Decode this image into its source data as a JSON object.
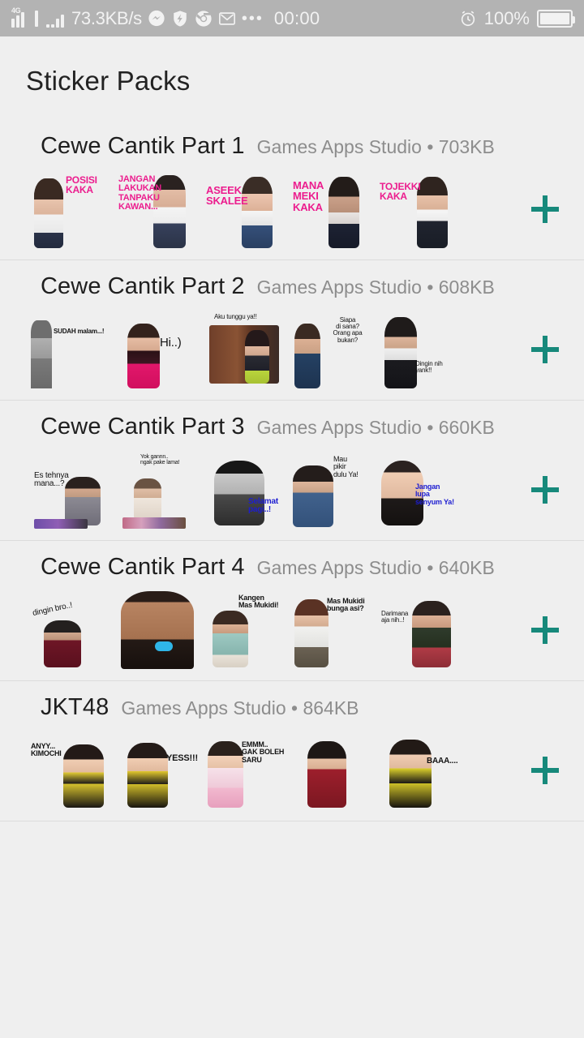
{
  "statusbar": {
    "network_label": "4G",
    "speed": "73.3KB/s",
    "time": "00:00",
    "battery_percent": "100%",
    "icons": [
      "messenger-icon",
      "shield-icon",
      "chrome-icon",
      "gmail-icon",
      "more-dots-icon",
      "alarm-icon",
      "battery-icon"
    ]
  },
  "header": {
    "title": "Sticker Packs"
  },
  "add_button_label": "+",
  "publisher": "Games Apps Studio",
  "packs": [
    {
      "name": "Cewe Cantik Part 1",
      "meta": "Games Apps Studio • 703KB",
      "stickers": [
        {
          "caption": "POSISI\nKAKA",
          "color": "pink"
        },
        {
          "caption": "JANGAN\nLAKUKAN\nTANPAKU\nKAWAN...",
          "color": "pink"
        },
        {
          "caption": "ASEEK\nSKALEE",
          "color": "pink"
        },
        {
          "caption": "MANA\nMEKI\nKAKA",
          "color": "pink"
        },
        {
          "caption": "TOJEKKI\nKAKA",
          "color": "pink"
        }
      ]
    },
    {
      "name": "Cewe Cantik Part 2",
      "meta": "Games Apps Studio • 608KB",
      "stickers": [
        {
          "caption": "SUDAH malam...!",
          "color": "black"
        },
        {
          "caption": "Hi..)",
          "color": "black"
        },
        {
          "caption": "Aku tunggu ya!!",
          "color": "black"
        },
        {
          "caption": "Siapa\ndi sana?\nOrang apa bukan?",
          "color": "black"
        },
        {
          "caption": "Dingin nih\nyank!!",
          "color": "black"
        }
      ]
    },
    {
      "name": "Cewe Cantik Part 3",
      "meta": "Games Apps Studio • 660KB",
      "stickers": [
        {
          "caption": "Es tehnya\nmana...?",
          "color": "black"
        },
        {
          "caption": "Yok gannn..\nngak pake lama!",
          "color": "black"
        },
        {
          "caption": "Selamat\npagi..!",
          "color": "blue"
        },
        {
          "caption": "Mau\npikir\ndulu Ya!",
          "color": "black"
        },
        {
          "caption": "Jangan\nlupa\nsenyum Ya!",
          "color": "blue"
        }
      ]
    },
    {
      "name": "Cewe Cantik Part 4",
      "meta": "Games Apps Studio • 640KB",
      "stickers": [
        {
          "caption": "dingin bro..!",
          "color": "black"
        },
        {
          "caption": "",
          "color": "black"
        },
        {
          "caption": "Kangen\nMas Mukidi!",
          "color": "black"
        },
        {
          "caption": "Mas Mukidi\nbunga asi?",
          "color": "black"
        },
        {
          "caption": "Darimana\naja nih..!",
          "color": "black"
        }
      ]
    },
    {
      "name": "JKT48",
      "meta": "Games Apps Studio • 864KB",
      "stickers": [
        {
          "caption": "ANYY...\nKIMOCHI",
          "color": "black"
        },
        {
          "caption": "YESS!!!",
          "color": "black"
        },
        {
          "caption": "EMMM..\nGAK BOLEH\nSARU",
          "color": "black"
        },
        {
          "caption": "",
          "color": "black"
        },
        {
          "caption": "BAAA....",
          "color": "black"
        }
      ]
    }
  ]
}
